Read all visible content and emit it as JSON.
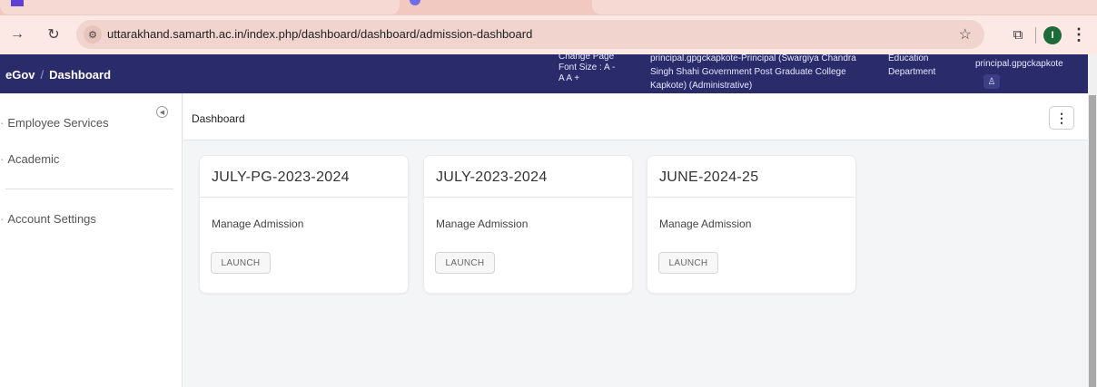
{
  "browser": {
    "url": "uttarakhand.samarth.ac.in/index.php/dashboard/dashboard/admission-dashboard",
    "profile_initial": "I"
  },
  "header": {
    "breadcrumb_root": "eGov",
    "breadcrumb_separator": "/",
    "breadcrumb_current": "Dashboard",
    "font_size_label1": "Change Page",
    "font_size_label2": "Font Size :",
    "font_decrease": "A -",
    "font_reset": "A",
    "font_increase": "A +",
    "user_role": "principal.gpgckapkote-Principal (Swargiya Chandra Singh Shahi Government Post Graduate College Kapkote) (Administrative)",
    "department": "Education Department",
    "username": "principal.gpgckapkote"
  },
  "sidebar": {
    "items": [
      {
        "label": "Employee Services"
      },
      {
        "label": "Academic"
      },
      {
        "label": "Account Settings"
      }
    ]
  },
  "main": {
    "title": "Dashboard",
    "cards": [
      {
        "title": "JULY-PG-2023-2024",
        "link": "Manage Admission",
        "button": "LAUNCH"
      },
      {
        "title": "JULY-2023-2024",
        "link": "Manage Admission",
        "button": "LAUNCH"
      },
      {
        "title": "JUNE-2024-25",
        "link": "Manage Admission",
        "button": "LAUNCH"
      }
    ]
  },
  "colors": {
    "header_bg": "#2a2b6a",
    "page_bg": "#f4f5f7",
    "tab_strip": "#f2c9c0"
  }
}
